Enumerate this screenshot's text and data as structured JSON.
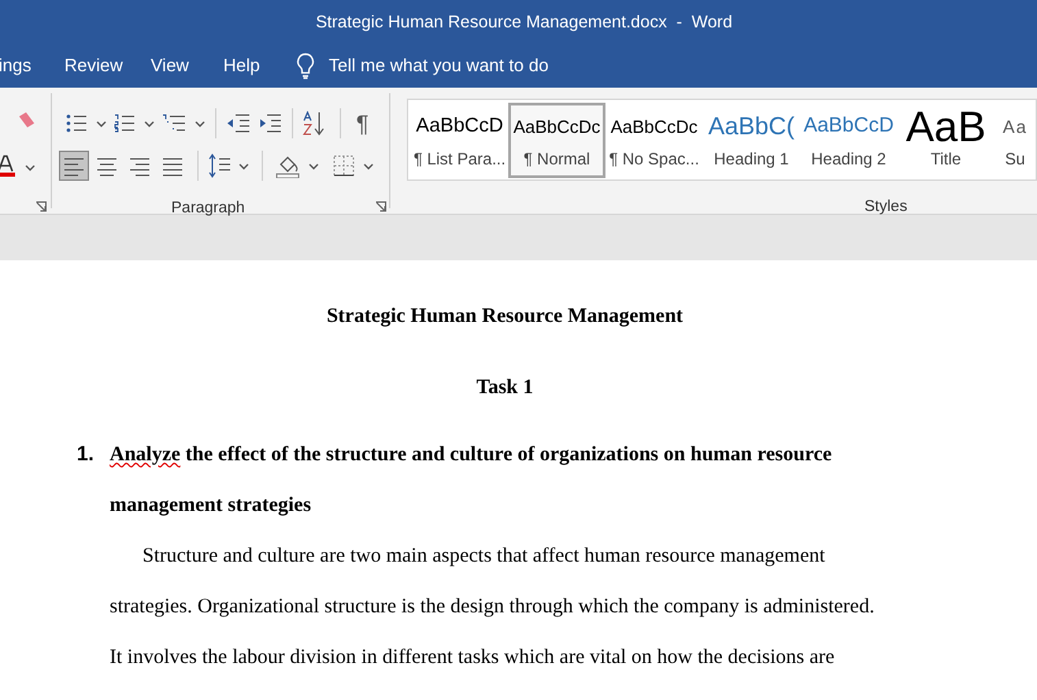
{
  "window": {
    "title": "Strategic Human Resource Management.docx  -  Word"
  },
  "menu_tabs": [
    {
      "label": "ings",
      "selected": false
    },
    {
      "label": "Review",
      "selected": false
    },
    {
      "label": "View",
      "selected": false
    },
    {
      "label": "Help",
      "selected": false
    }
  ],
  "tell_me": {
    "placeholder": "Tell me what you want to do"
  },
  "paragraph_group": {
    "label": "Paragraph",
    "alignments": [
      {
        "kind": "left",
        "selected": true
      },
      {
        "kind": "center",
        "selected": false
      },
      {
        "kind": "right",
        "selected": false
      },
      {
        "kind": "justify",
        "selected": false
      }
    ],
    "show_marks_glyph": "¶"
  },
  "styles_group": {
    "label": "Styles",
    "items": [
      {
        "preview": "AaBbCcD",
        "name": "¶ List Para...",
        "kind": "normal",
        "selected": false
      },
      {
        "preview": "AaBbCcDc",
        "name": "¶ Normal",
        "kind": "small",
        "selected": true
      },
      {
        "preview": "AaBbCcDc",
        "name": "¶ No Spac...",
        "kind": "small",
        "selected": false
      },
      {
        "preview": "AaBbC(",
        "name": "Heading 1",
        "kind": "heading1",
        "selected": false
      },
      {
        "preview": "AaBbCcD",
        "name": "Heading 2",
        "kind": "heading2",
        "selected": false
      },
      {
        "preview": "AaB",
        "name": "Title",
        "kind": "title",
        "selected": false
      },
      {
        "preview": "Aa",
        "name": "Su",
        "kind": "subtitle",
        "selected": false
      }
    ]
  },
  "document": {
    "title": "Strategic Human Resource Management",
    "section": "Task 1",
    "list_item": {
      "number": "1.",
      "lines": [
        [
          {
            "text": "Analyze",
            "misspelled": true
          },
          {
            "text": " the effect of the structure and culture of organizations on human resource",
            "misspelled": false
          }
        ],
        [
          {
            "text": "management strategies",
            "misspelled": false
          }
        ]
      ]
    },
    "paragraph_lines": [
      "Structure and culture are two main aspects that affect human resource management",
      "strategies. Organizational structure is the design through which the company is administered.",
      "It involves the labour division in different tasks which are vital on how the decisions are"
    ]
  }
}
